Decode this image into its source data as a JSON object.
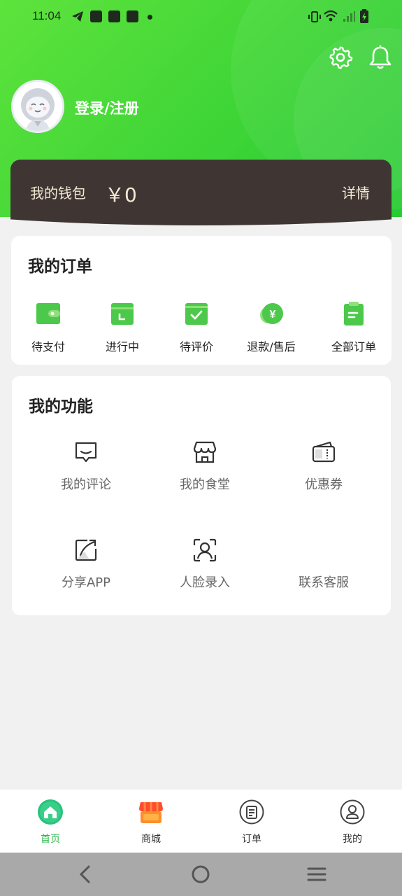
{
  "status_bar": {
    "time": "11:04"
  },
  "header": {
    "login_text": "登录/注册",
    "icons": [
      "gear-icon",
      "bell-icon"
    ]
  },
  "wallet": {
    "label": "我的钱包",
    "amount": "￥0",
    "detail_link": "详情"
  },
  "orders": {
    "title": "我的订单",
    "items": [
      {
        "label": "待支付",
        "icon": "wallet-icon"
      },
      {
        "label": "进行中",
        "icon": "calendar-clock-icon"
      },
      {
        "label": "待评价",
        "icon": "check-box-icon"
      },
      {
        "label": "退款/售后",
        "icon": "yen-refund-icon"
      },
      {
        "label": "全部订单",
        "icon": "clipboard-icon"
      }
    ]
  },
  "features": {
    "title": "我的功能",
    "items": [
      {
        "label": "我的评论",
        "icon": "comment-icon"
      },
      {
        "label": "我的食堂",
        "icon": "store-icon"
      },
      {
        "label": "优惠券",
        "icon": "coupon-icon"
      },
      {
        "label": "分享APP",
        "icon": "share-icon"
      },
      {
        "label": "人脸录入",
        "icon": "face-scan-icon"
      },
      {
        "label": "联系客服",
        "icon": ""
      }
    ]
  },
  "tabbar": {
    "items": [
      {
        "label": "首页",
        "icon": "home-icon",
        "active": true
      },
      {
        "label": "商城",
        "icon": "shop-icon",
        "active": false
      },
      {
        "label": "订单",
        "icon": "order-icon",
        "active": false
      },
      {
        "label": "我的",
        "icon": "user-icon",
        "active": false
      }
    ]
  },
  "colors": {
    "header_green": "#3fd537",
    "wallet_bg": "#3f3633",
    "wallet_text": "#f4e8d6",
    "accent_green": "#2fb84a",
    "icon_green": "#4cc94a"
  }
}
